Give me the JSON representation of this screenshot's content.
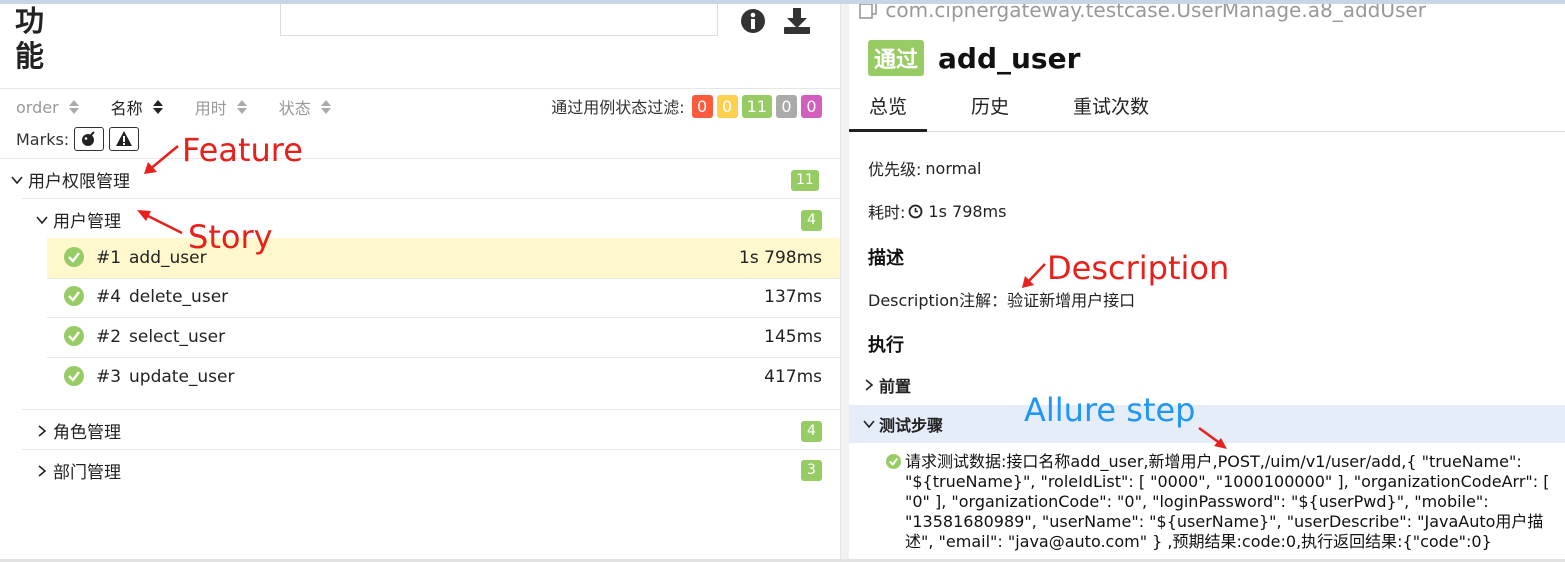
{
  "left": {
    "title": "功能",
    "sort_columns": [
      "order",
      "名称",
      "用时",
      "状态"
    ],
    "filter_label": "通过用例状态过滤:",
    "filter_counts": [
      {
        "value": "0",
        "color": "#fd5a3e"
      },
      {
        "value": "0",
        "color": "#ffd050"
      },
      {
        "value": "11",
        "color": "#97cc64"
      },
      {
        "value": "0",
        "color": "#aaaaaa"
      },
      {
        "value": "0",
        "color": "#d35ebe"
      }
    ],
    "marks_label": "Marks:",
    "marks_icons": [
      "bomb-icon",
      "warning-icon"
    ],
    "feature": {
      "label": "用户权限管理",
      "count": "11"
    },
    "story": {
      "label": "用户管理",
      "count": "4"
    },
    "cases": [
      {
        "num": "#1",
        "name": "add_user",
        "duration": "1s 798ms",
        "selected": true
      },
      {
        "num": "#4",
        "name": "delete_user",
        "duration": "137ms",
        "selected": false
      },
      {
        "num": "#2",
        "name": "select_user",
        "duration": "145ms",
        "selected": false
      },
      {
        "num": "#3",
        "name": "update_user",
        "duration": "417ms",
        "selected": false
      }
    ],
    "groups": [
      {
        "label": "角色管理",
        "count": "4"
      },
      {
        "label": "部门管理",
        "count": "3"
      }
    ]
  },
  "annotations": {
    "feature": "Feature",
    "story": "Story",
    "description": "Description",
    "allure_step": "Allure step"
  },
  "right": {
    "path": "com.cipnergateway.testcase.UserManage.a8_addUser",
    "status": "通过",
    "case_title": "add_user",
    "tabs": [
      "总览",
      "历史",
      "重试次数"
    ],
    "priority_label": "优先级:",
    "priority_value": "normal",
    "duration_label": "耗时:",
    "duration_value": "1s 798ms",
    "description_heading": "描述",
    "description_text": "Description注解：验证新增用户接口",
    "execution_heading": "执行",
    "setup_label": "前置",
    "steps_label": "测试步骤",
    "step_text": "请求测试数据:接口名称add_user,新增用户,POST,/uim/v1/user/add,{ \"trueName\": \"${trueName}\", \"roleIdList\": [ \"0000\", \"1000100000\" ], \"organizationCodeArr\": [ \"0\" ], \"organizationCode\": \"0\", \"loginPassword\": \"${userPwd}\", \"mobile\": \"13581680989\", \"userName\": \"${userName}\", \"userDescribe\": \"JavaAuto用户描述\", \"email\": \"java@auto.com\" } ,预期结果:code:0,执行返回结果:{\"code\":0}"
  }
}
